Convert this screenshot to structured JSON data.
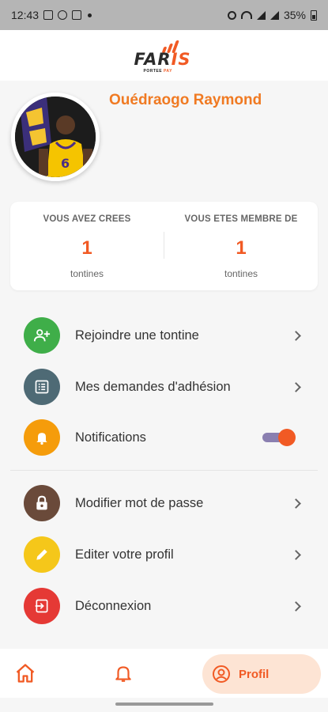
{
  "status_bar": {
    "time": "12:43",
    "battery": "35%"
  },
  "app": {
    "logo_text_main": "FAR",
    "logo_text_accent": "IS",
    "logo_sub_main": "PORTEE",
    "logo_sub_accent": "PAY",
    "brand_color": "#f15a24"
  },
  "profile": {
    "name": "Ouédraogo Raymond",
    "name_color": "#f07a22"
  },
  "stats": [
    {
      "label": "VOUS AVEZ CREES",
      "value": "1",
      "unit": "tontines"
    },
    {
      "label": "VOUS ETES MEMBRE DE",
      "value": "1",
      "unit": "tontines"
    }
  ],
  "menu": {
    "join": {
      "label": "Rejoindre une tontine",
      "icon": "add-user-icon",
      "color": "#3fae49"
    },
    "requests": {
      "label": "Mes demandes d'adhésion",
      "icon": "list-icon",
      "color": "#4e6a75"
    },
    "notifications": {
      "label": "Notifications",
      "icon": "bell-icon",
      "color": "#f59c0b",
      "enabled": true
    },
    "password": {
      "label": "Modifier mot de passe",
      "icon": "lock-icon",
      "color": "#6a4a3a"
    },
    "edit_profile": {
      "label": "Editer votre profil",
      "icon": "pencil-icon",
      "color": "#f5c71a"
    },
    "logout": {
      "label": "Déconnexion",
      "icon": "logout-icon",
      "color": "#e53935"
    }
  },
  "bottom_nav": {
    "home": {
      "icon": "home-icon"
    },
    "notifications": {
      "icon": "bell-icon"
    },
    "profile": {
      "label": "Profil",
      "icon": "profile-icon",
      "active": true
    }
  }
}
